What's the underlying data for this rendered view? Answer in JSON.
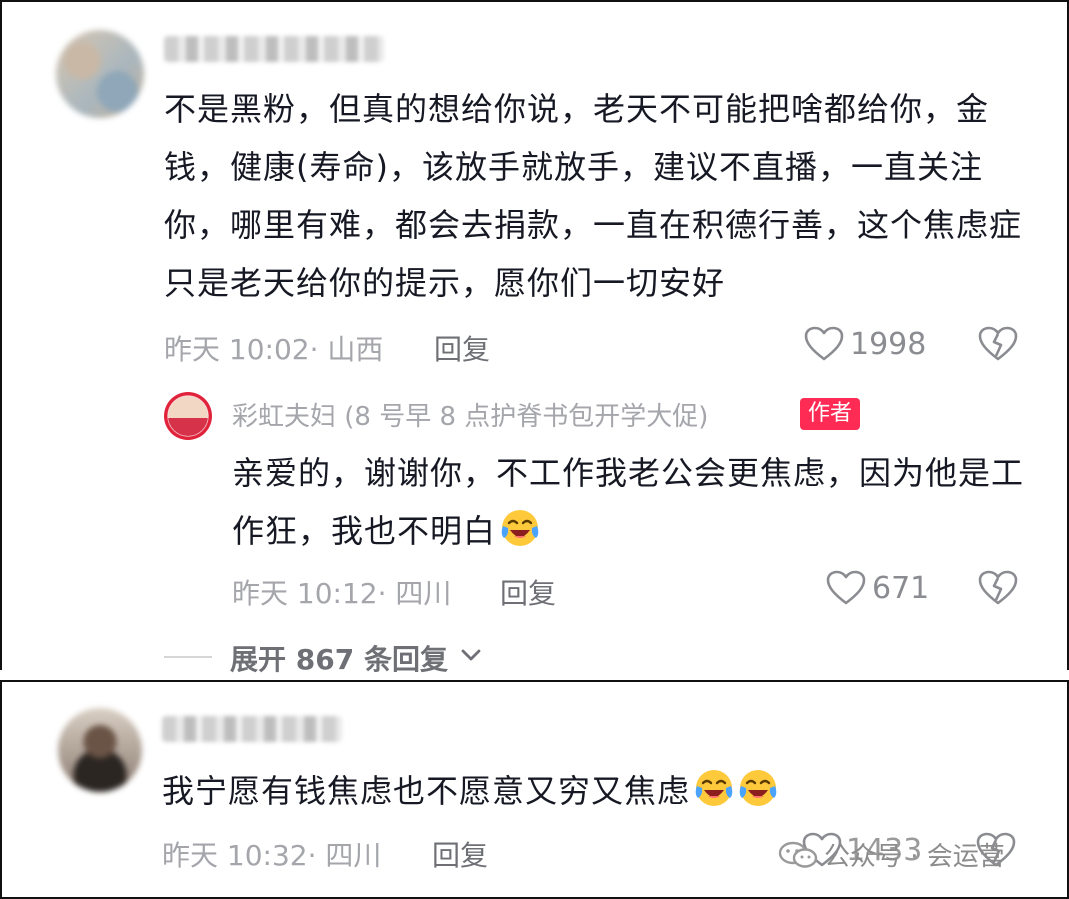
{
  "comment1": {
    "text": "不是黑粉，但真的想给你说，老天不可能把啥都给你，金钱，健康(寿命)，该放手就放手，建议不直播，一直关注你，哪里有难，都会去捐款，一直在积德行善，这个焦虑症只是老天给你的提示，愿你们一切安好",
    "meta": "昨天 10:02· 山西",
    "reply_label": "回复",
    "likes": "1998",
    "icons": [
      "heart-outline",
      "heart-broken-outline"
    ]
  },
  "comment2": {
    "author": "彩虹夫妇 (8 号早 8 点护脊书包开学大促)",
    "badge": "作者",
    "text": "亲爱的，谢谢你，不工作我老公会更焦虑，因为他是工作狂，我也不明白",
    "emoji_count": 1,
    "meta": "昨天 10:12· 四川",
    "reply_label": "回复",
    "likes": "671"
  },
  "expand": {
    "label": "展开 867 条回复"
  },
  "comment3": {
    "text": "我宁愿有钱焦虑也不愿意又穷又焦虑",
    "emoji": "tears-of-joy",
    "meta": "昨天 10:32· 四川",
    "reply_label": "回复",
    "likes": "1433"
  },
  "watermark": {
    "text": "公众号 · 会运营"
  },
  "colors": {
    "badge_bg": "#fe2c55",
    "meta_gray": "#a4a6ab",
    "text_dark": "#161823",
    "emoji_yellow": "#ffc93c"
  }
}
